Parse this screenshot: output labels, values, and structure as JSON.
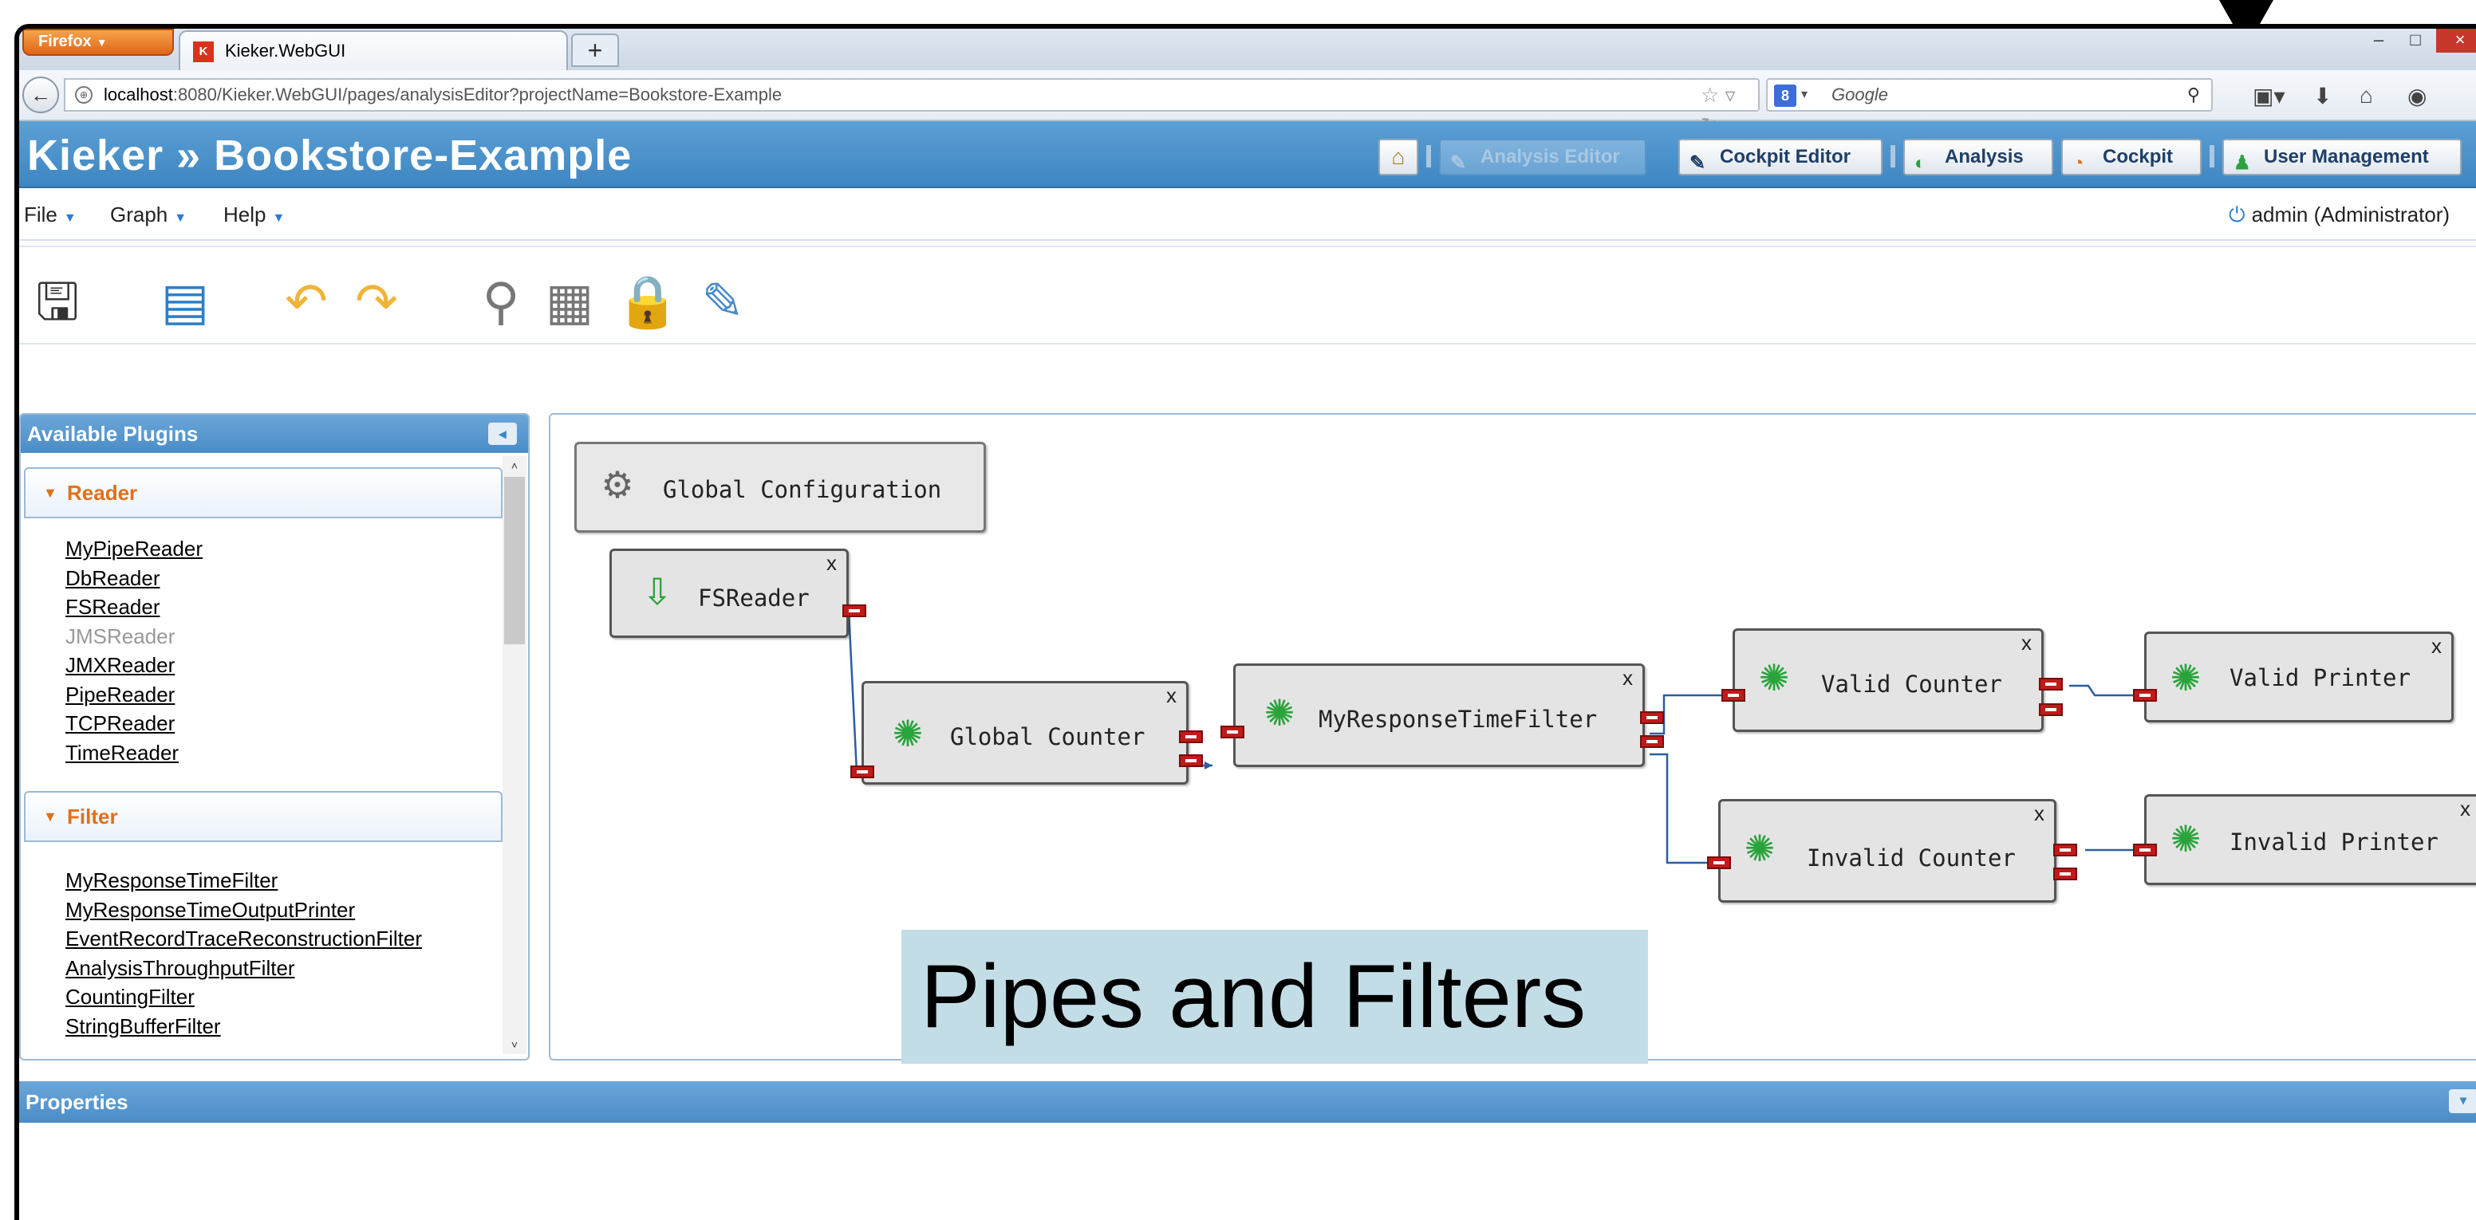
{
  "browser": {
    "menu_button": "Firefox",
    "tab_title": "Kieker.WebGUI",
    "new_tab": "+",
    "url_host": "localhost",
    "url_rest": ":8080/Kieker.WebGUI/pages/analysisEditor?projectName=Bookstore-Example",
    "search_placeholder": "Google",
    "window_min": "–",
    "window_max": "□",
    "window_close": "×"
  },
  "app": {
    "title": "Kieker » Bookstore-Example",
    "nav": {
      "analysis_editor": "Analysis Editor",
      "cockpit_editor": "Cockpit Editor",
      "analysis": "Analysis",
      "cockpit": "Cockpit",
      "user_management": "User Management"
    },
    "menus": [
      "File",
      "Graph",
      "Help"
    ],
    "user": "admin (Administrator)"
  },
  "plugins": {
    "header": "Available Plugins",
    "sections": [
      {
        "title": "Reader",
        "items": [
          {
            "label": "MyPipeReader",
            "enabled": true
          },
          {
            "label": "DbReader",
            "enabled": true
          },
          {
            "label": "FSReader",
            "enabled": true
          },
          {
            "label": "JMSReader",
            "enabled": false
          },
          {
            "label": "JMXReader",
            "enabled": true
          },
          {
            "label": "PipeReader",
            "enabled": true
          },
          {
            "label": "TCPReader",
            "enabled": true
          },
          {
            "label": "TimeReader",
            "enabled": true
          }
        ]
      },
      {
        "title": "Filter",
        "items": [
          {
            "label": "MyResponseTimeFilter",
            "enabled": true
          },
          {
            "label": "MyResponseTimeOutputPrinter",
            "enabled": true
          },
          {
            "label": "EventRecordTraceReconstructionFilter",
            "enabled": true
          },
          {
            "label": "AnalysisThroughputFilter",
            "enabled": true
          },
          {
            "label": "CountingFilter",
            "enabled": true
          },
          {
            "label": "StringBufferFilter",
            "enabled": true
          }
        ]
      }
    ]
  },
  "graph": {
    "global_config": "Global Configuration",
    "nodes": {
      "fsreader": "FSReader",
      "global_counter": "Global Counter",
      "response_filter": "MyResponseTimeFilter",
      "valid_counter": "Valid Counter",
      "valid_printer": "Valid Printer",
      "invalid_counter": "Invalid Counter",
      "invalid_printer": "Invalid Printer"
    },
    "close_glyph": "x"
  },
  "overlay_text": "Pipes and Filters",
  "properties": {
    "header": "Properties"
  },
  "colors": {
    "header_blue": "#4b8cc7",
    "port_red": "#c21a1a",
    "accent_orange": "#e0701a"
  }
}
